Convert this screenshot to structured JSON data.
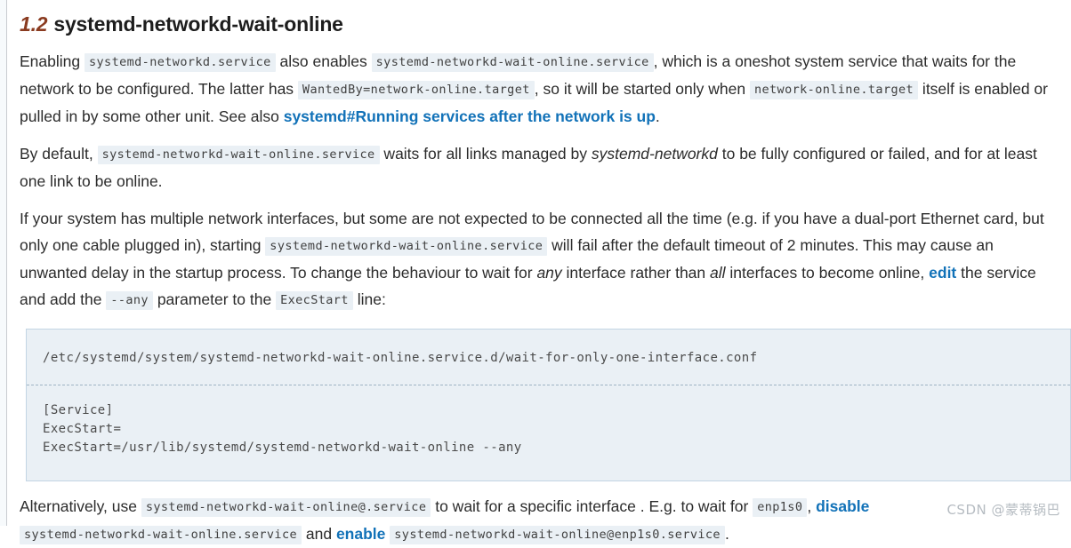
{
  "heading": {
    "number": "1.2",
    "title": "systemd-networkd-wait-online",
    "number_color": "#8a3b20"
  },
  "paragraphs": {
    "p1": {
      "t1": "Enabling ",
      "c1": "systemd-networkd.service",
      "t2": " also enables ",
      "c2": "systemd-networkd-wait-online.service",
      "t3": ", which is a oneshot system service that waits for the network to be configured. The latter has ",
      "c3": "WantedBy=network-online.target",
      "t4": ", so it will be started only when ",
      "c4": "network-online.target",
      "t5": " itself is enabled or pulled in by some other unit. See also ",
      "link1": "systemd#Running services after the network is up",
      "t6": "."
    },
    "p2": {
      "t1": "By default, ",
      "c1": "systemd-networkd-wait-online.service",
      "t2": " waits for all links managed by ",
      "i1": "systemd-networkd",
      "t3": " to be fully configured or failed, and for at least one link to be online."
    },
    "p3": {
      "t1": "If your system has multiple network interfaces, but some are not expected to be connected all the time (e.g. if you have a dual-port Ethernet card, but only one cable plugged in), starting ",
      "c1": "systemd-networkd-wait-online.service",
      "t2": " will fail after the default timeout of 2 minutes. This may cause an unwanted delay in the startup process. To change the behaviour to wait for ",
      "i1": "any",
      "t3": " interface rather than ",
      "i2": "all",
      "t4": " interfaces to become online, ",
      "link1": "edit",
      "t5": " the service and add the ",
      "c2": "--any",
      "t6": " parameter to the ",
      "c3": "ExecStart",
      "t7": " line:"
    },
    "p4": {
      "t1": "Alternatively, use ",
      "c1": "systemd-networkd-wait-online@.service",
      "t2": " to wait for a specific interface . E.g. to wait for ",
      "c2": "enp1s0",
      "t3": ", ",
      "link1": "disable",
      "t4": " ",
      "c3": "systemd-networkd-wait-online.service",
      "t5": " and ",
      "link2": "enable",
      "t6": " ",
      "c4": "systemd-networkd-wait-online@enp1s0.service",
      "t7": "."
    }
  },
  "codeblock": {
    "filepath": "/etc/systemd/system/systemd-networkd-wait-online.service.d/wait-for-only-one-interface.conf",
    "content": "[Service]\nExecStart=\nExecStart=/usr/lib/systemd/systemd-networkd-wait-online --any",
    "background": "#eaf0f5",
    "border_color": "#c3d5e4"
  },
  "watermark": {
    "text": "CSDN @蒙蒂锅巴"
  },
  "colors": {
    "link": "#1272b8",
    "inline_code_bg": "#eaf0f5",
    "text": "#2b2b2b"
  }
}
